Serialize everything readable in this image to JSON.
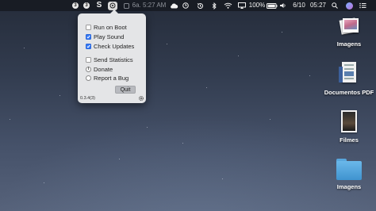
{
  "menubar": {
    "badge_a": "3",
    "badge_b": "3",
    "app_letter": "S",
    "clock_faded": "6a. 5:27 AM",
    "battery_percent": "100%",
    "date": "6/10",
    "time": "05:27"
  },
  "popup": {
    "items": [
      {
        "label": "Run on Boot",
        "checked": false
      },
      {
        "label": "Play Sound",
        "checked": true
      },
      {
        "label": "Check Updates",
        "checked": true
      },
      {
        "label": "Send Statistics",
        "checked": false
      }
    ],
    "donate_label": "Donate",
    "report_label": "Report a Bug",
    "quit_label": "Quit",
    "version": "0.3.4(3)"
  },
  "desktop": {
    "icons": [
      {
        "label": "Imagens",
        "icon": "photos-folder-icon"
      },
      {
        "label": "Documentos PDF",
        "icon": "pdf-documents-icon"
      },
      {
        "label": "Filmes",
        "icon": "movies-icon"
      },
      {
        "label": "Imagens",
        "icon": "blue-folder-icon"
      }
    ]
  }
}
